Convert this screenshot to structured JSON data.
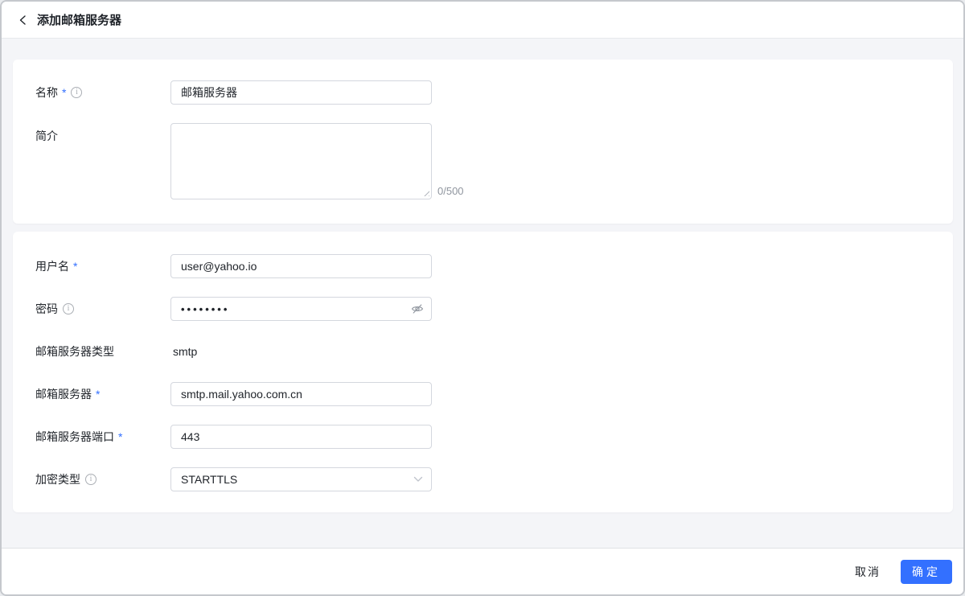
{
  "ui": {
    "required_marker": "*",
    "info_glyph": "i"
  },
  "header": {
    "title": "添加邮箱服务器"
  },
  "form": {
    "name": {
      "label": "名称",
      "value": "邮箱服务器"
    },
    "description": {
      "label": "简介",
      "value": "",
      "counter": "0/500"
    },
    "username": {
      "label": "用户名",
      "value": "user@yahoo.io"
    },
    "password": {
      "label": "密码",
      "value": "••••••••"
    },
    "server_type": {
      "label": "邮箱服务器类型",
      "value": "smtp"
    },
    "host": {
      "label": "邮箱服务器",
      "value": "smtp.mail.yahoo.com.cn"
    },
    "port": {
      "label": "邮箱服务器端口",
      "value": "443"
    },
    "encryption": {
      "label": "加密类型",
      "value": "STARTTLS"
    }
  },
  "footer": {
    "cancel_label": "取消",
    "confirm_label": "确定"
  },
  "colors": {
    "primary": "#3370ff",
    "asterisk": "#3370ff",
    "page_bg": "#f4f5f8"
  }
}
